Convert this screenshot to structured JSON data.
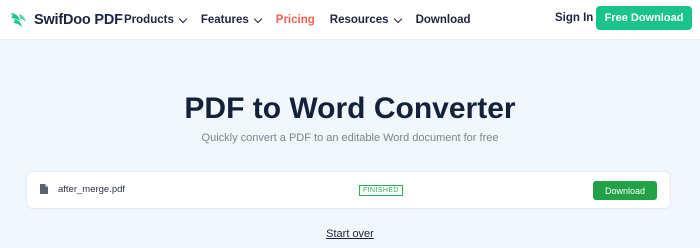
{
  "brand": {
    "name": "SwifDoo PDF",
    "accent": "#19c48a"
  },
  "nav": {
    "items": [
      {
        "label": "Products",
        "has_dropdown": true
      },
      {
        "label": "Features",
        "has_dropdown": true
      },
      {
        "label": "Pricing",
        "active": true,
        "color": "#f0644f"
      },
      {
        "label": "Resources",
        "has_dropdown": true
      },
      {
        "label": "Download"
      }
    ],
    "sign_in": "Sign In",
    "cta": "Free Download"
  },
  "hero": {
    "title": "PDF to Word Converter",
    "subtitle": "Quickly convert a PDF to an editable Word document for free"
  },
  "file": {
    "icon": "file-icon",
    "name": "after_merge.pdf",
    "status": "FINISHED",
    "status_color": "#31b05a",
    "download_label": "Download",
    "download_color": "#22a246"
  },
  "start_over": "Start over"
}
